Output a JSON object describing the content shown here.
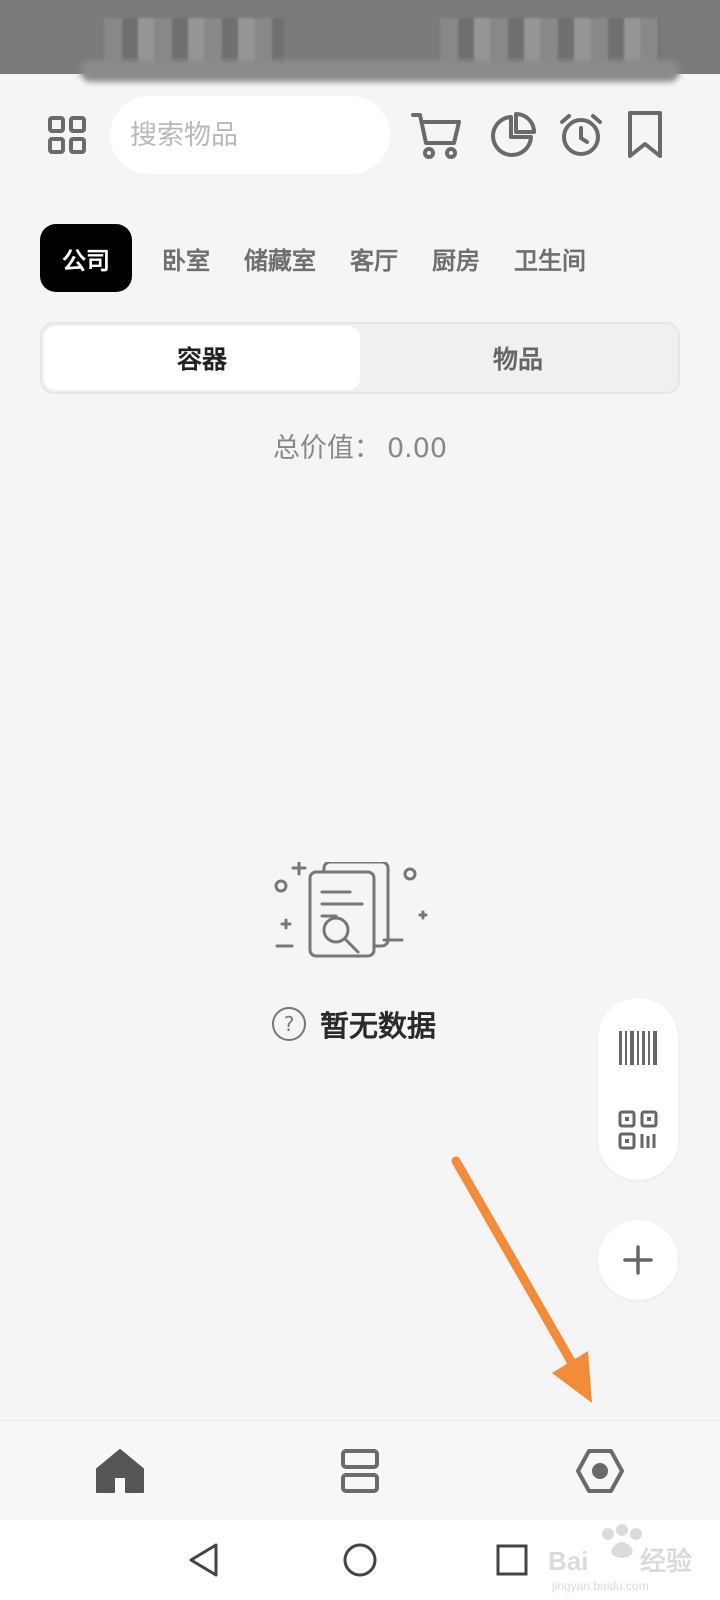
{
  "search": {
    "placeholder": "搜索物品"
  },
  "toolbar_icons": [
    "grid-icon",
    "cart-icon",
    "pie-chart-icon",
    "alarm-clock-icon",
    "bookmark-icon"
  ],
  "rooms": {
    "items": [
      {
        "label": "公司",
        "active": true
      },
      {
        "label": "卧室",
        "active": false
      },
      {
        "label": "储藏室",
        "active": false
      },
      {
        "label": "客厅",
        "active": false
      },
      {
        "label": "厨房",
        "active": false
      },
      {
        "label": "卫生间",
        "active": false
      }
    ]
  },
  "segment": {
    "options": [
      {
        "label": "容器",
        "active": true
      },
      {
        "label": "物品",
        "active": false
      }
    ]
  },
  "summary": {
    "total_label": "总价值：",
    "total_value": "0.00"
  },
  "empty_state": {
    "text": "暂无数据"
  },
  "fab": {
    "icons": [
      "barcode-icon",
      "qr-code-icon",
      "plus-icon"
    ]
  },
  "bottom_nav": {
    "icons": [
      "home-icon",
      "list-icon",
      "settings-hexagon-icon"
    ],
    "active_index": 0
  },
  "system_nav": {
    "icons": [
      "back-icon",
      "home-circle-icon",
      "recents-icon"
    ]
  },
  "colors": {
    "accent": "#000000",
    "background": "#f5f5f5",
    "arrow": "#f28c3a",
    "icon": "#6a6a6a"
  }
}
